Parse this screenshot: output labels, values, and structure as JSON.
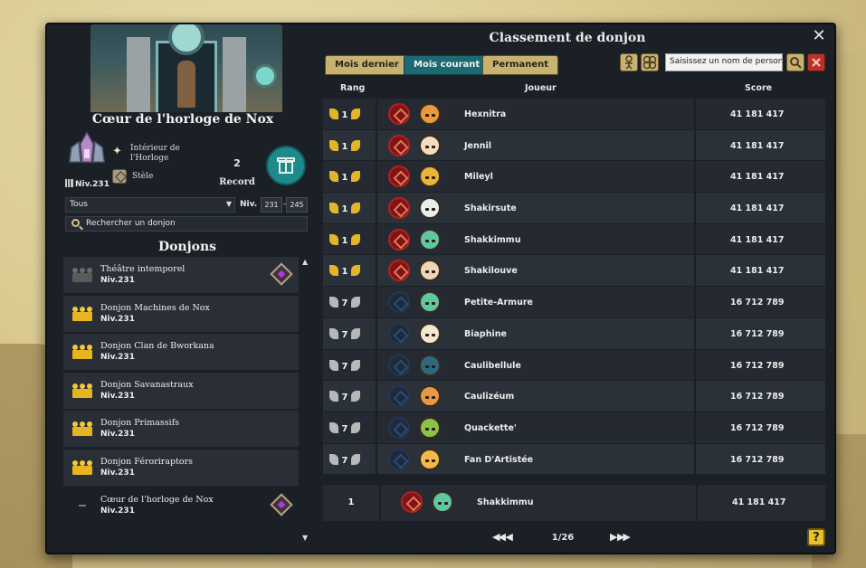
{
  "window": {
    "title": "Classement de donjon",
    "close_label": "✕"
  },
  "dungeon": {
    "name": "Cœur de l'horloge de Nox",
    "zone": "Intérieur de l'Horloge",
    "level": "Niv.231",
    "monument": "Stèle",
    "record_value": "2",
    "record_label": "Record"
  },
  "filters": {
    "type_selected": "Tous",
    "level_label": "Niv.",
    "level_min": "231",
    "level_sep": "-",
    "level_max": "245",
    "search_placeholder": "Rechercher un donjon"
  },
  "donjons": {
    "title": "Donjons",
    "items": [
      {
        "name": "Théâtre intemporel",
        "level": "Niv.231",
        "crown": "gray"
      },
      {
        "name": "Donjon Machines de Nox",
        "level": "Niv.231",
        "crown": "gold"
      },
      {
        "name": "Donjon Clan de Bworkana",
        "level": "Niv.231",
        "crown": "gold"
      },
      {
        "name": "Donjon Savanastraux",
        "level": "Niv.231",
        "crown": "gold"
      },
      {
        "name": "Donjon Primassifs",
        "level": "Niv.231",
        "crown": "gold"
      },
      {
        "name": "Donjon Féroriraptors",
        "level": "Niv.231",
        "crown": "gold"
      },
      {
        "name": "Cœur de l'horloge de Nox",
        "level": "Niv.231",
        "crown": "none"
      }
    ]
  },
  "tabs": [
    {
      "label": "Mois dernier",
      "active": false
    },
    {
      "label": "Mois courant",
      "active": true
    },
    {
      "label": "Permanent",
      "active": false
    }
  ],
  "player_search": {
    "placeholder": "Saisissez un nom de personnage"
  },
  "table": {
    "headers": {
      "rank": "Rang",
      "player": "Joueur",
      "score": "Score"
    },
    "rows": [
      {
        "rank": "1",
        "medal": "gold",
        "align": "red",
        "skin": "#e89a3c",
        "name": "Hexnitra",
        "score": "41 181 417"
      },
      {
        "rank": "1",
        "medal": "gold",
        "align": "red",
        "skin": "#f3dcc0",
        "name": "Jennil",
        "score": "41 181 417"
      },
      {
        "rank": "1",
        "medal": "gold",
        "align": "red",
        "skin": "#e9b43a",
        "name": "Mileyl",
        "score": "41 181 417"
      },
      {
        "rank": "1",
        "medal": "gold",
        "align": "red",
        "skin": "#e6eef2",
        "name": "Shakirsute",
        "score": "41 181 417"
      },
      {
        "rank": "1",
        "medal": "gold",
        "align": "red",
        "skin": "#5fc7a3",
        "name": "Shakkimmu",
        "score": "41 181 417"
      },
      {
        "rank": "1",
        "medal": "gold",
        "align": "red",
        "skin": "#f0d6b8",
        "name": "Shakilouve",
        "score": "41 181 417"
      },
      {
        "rank": "7",
        "medal": "silver",
        "align": "blue",
        "skin": "#5fc7a3",
        "name": "Petite-Armure",
        "score": "16 712 789"
      },
      {
        "rank": "7",
        "medal": "silver",
        "align": "blue",
        "skin": "#f3e6d2",
        "name": "Biaphine",
        "score": "16 712 789"
      },
      {
        "rank": "7",
        "medal": "silver",
        "align": "blue",
        "skin": "#2d6a80",
        "name": "Caulibellule",
        "score": "16 712 789"
      },
      {
        "rank": "7",
        "medal": "silver",
        "align": "blue",
        "skin": "#e79a45",
        "name": "Caulizéum",
        "score": "16 712 789"
      },
      {
        "rank": "7",
        "medal": "silver",
        "align": "blue",
        "skin": "#8ac24a",
        "name": "Quackette'",
        "score": "16 712 789"
      },
      {
        "rank": "7",
        "medal": "silver",
        "align": "blue",
        "skin": "#f0b94a",
        "name": "Fan D'Artistée",
        "score": "16 712 789"
      }
    ]
  },
  "my_row": {
    "rank": "1",
    "align": "red",
    "skin": "#5fc7a3",
    "name": "Shakkimmu",
    "score": "41 181 417"
  },
  "pager": {
    "prev_label": "◀◀ ◀",
    "text": "1/26",
    "next_label": "▶ ▶▶"
  },
  "help_label": "?",
  "colors": {
    "panel": "#1b2027",
    "tab_active": "#1b6a72",
    "tab_inactive": "#c8b272",
    "gold": "#e3b52a",
    "alignment_red": "#7e1414",
    "alignment_blue": "#1d2a3d"
  }
}
